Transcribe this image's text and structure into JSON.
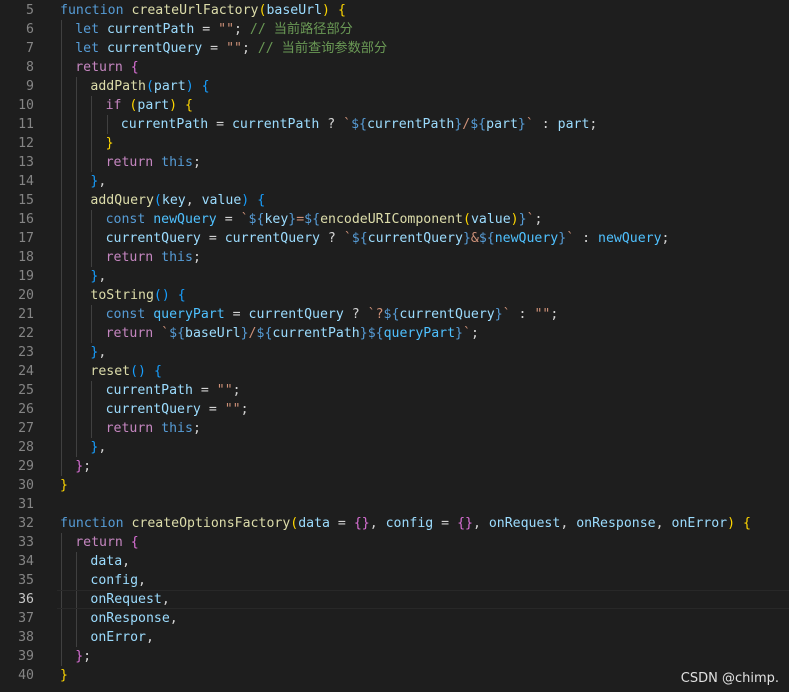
{
  "editor": {
    "language": "javascript",
    "active_line": 36,
    "colors": {
      "background": "#1e1e1e",
      "line_number": "#858585",
      "active_line_number": "#c6c6c6",
      "keyword": "#569cd6",
      "control": "#c586c0",
      "function": "#dcdcaa",
      "variable": "#9cdcfe",
      "constant": "#4fc1ff",
      "string": "#ce9178",
      "comment": "#6a9955",
      "bracket_level_1": "#ffd700",
      "bracket_level_2": "#da70d6",
      "bracket_level_3": "#179fff"
    },
    "lines": [
      {
        "n": "5",
        "guides": 0,
        "tokens": [
          [
            "keyword",
            "function "
          ],
          [
            "func",
            "createUrlFactory"
          ],
          [
            "b1",
            "("
          ],
          [
            "var",
            "baseUrl"
          ],
          [
            "b1",
            ")"
          ],
          [
            "plain",
            " "
          ],
          [
            "b1",
            "{"
          ]
        ]
      },
      {
        "n": "6",
        "guides": 1,
        "tokens": [
          [
            "keyword",
            "let "
          ],
          [
            "var",
            "currentPath"
          ],
          [
            "plain",
            " = "
          ],
          [
            "str",
            "\"\""
          ],
          [
            "plain",
            "; "
          ],
          [
            "comment",
            "// 当前路径部分"
          ]
        ]
      },
      {
        "n": "7",
        "guides": 1,
        "tokens": [
          [
            "keyword",
            "let "
          ],
          [
            "var",
            "currentQuery"
          ],
          [
            "plain",
            " = "
          ],
          [
            "str",
            "\"\""
          ],
          [
            "plain",
            "; "
          ],
          [
            "comment",
            "// 当前查询参数部分"
          ]
        ]
      },
      {
        "n": "8",
        "guides": 1,
        "tokens": [
          [
            "control",
            "return "
          ],
          [
            "b2",
            "{"
          ]
        ]
      },
      {
        "n": "9",
        "guides": 2,
        "tokens": [
          [
            "func",
            "addPath"
          ],
          [
            "b3",
            "("
          ],
          [
            "var",
            "part"
          ],
          [
            "b3",
            ")"
          ],
          [
            "plain",
            " "
          ],
          [
            "b3",
            "{"
          ]
        ]
      },
      {
        "n": "10",
        "guides": 3,
        "tokens": [
          [
            "control",
            "if "
          ],
          [
            "b1",
            "("
          ],
          [
            "var",
            "part"
          ],
          [
            "b1",
            ")"
          ],
          [
            "plain",
            " "
          ],
          [
            "b1",
            "{"
          ]
        ]
      },
      {
        "n": "11",
        "guides": 4,
        "tokens": [
          [
            "var",
            "currentPath"
          ],
          [
            "plain",
            " = "
          ],
          [
            "var",
            "currentPath"
          ],
          [
            "plain",
            " ? "
          ],
          [
            "str",
            "`"
          ],
          [
            "interp",
            "${"
          ],
          [
            "var",
            "currentPath"
          ],
          [
            "interp",
            "}"
          ],
          [
            "str",
            "/"
          ],
          [
            "interp",
            "${"
          ],
          [
            "var",
            "part"
          ],
          [
            "interp",
            "}"
          ],
          [
            "str",
            "`"
          ],
          [
            "plain",
            " : "
          ],
          [
            "var",
            "part"
          ],
          [
            "plain",
            ";"
          ]
        ]
      },
      {
        "n": "12",
        "guides": 3,
        "tokens": [
          [
            "b1",
            "}"
          ]
        ]
      },
      {
        "n": "13",
        "guides": 3,
        "tokens": [
          [
            "control",
            "return "
          ],
          [
            "keyword",
            "this"
          ],
          [
            "plain",
            ";"
          ]
        ]
      },
      {
        "n": "14",
        "guides": 2,
        "tokens": [
          [
            "b3",
            "}"
          ],
          [
            "plain",
            ","
          ]
        ]
      },
      {
        "n": "15",
        "guides": 2,
        "tokens": [
          [
            "func",
            "addQuery"
          ],
          [
            "b3",
            "("
          ],
          [
            "var",
            "key"
          ],
          [
            "plain",
            ", "
          ],
          [
            "var",
            "value"
          ],
          [
            "b3",
            ")"
          ],
          [
            "plain",
            " "
          ],
          [
            "b3",
            "{"
          ]
        ]
      },
      {
        "n": "16",
        "guides": 3,
        "tokens": [
          [
            "keyword",
            "const "
          ],
          [
            "const",
            "newQuery"
          ],
          [
            "plain",
            " = "
          ],
          [
            "str",
            "`"
          ],
          [
            "interp",
            "${"
          ],
          [
            "var",
            "key"
          ],
          [
            "interp",
            "}"
          ],
          [
            "str",
            "="
          ],
          [
            "interp",
            "${"
          ],
          [
            "func",
            "encodeURIComponent"
          ],
          [
            "b1",
            "("
          ],
          [
            "var",
            "value"
          ],
          [
            "b1",
            ")"
          ],
          [
            "interp",
            "}"
          ],
          [
            "str",
            "`"
          ],
          [
            "plain",
            ";"
          ]
        ]
      },
      {
        "n": "17",
        "guides": 3,
        "tokens": [
          [
            "var",
            "currentQuery"
          ],
          [
            "plain",
            " = "
          ],
          [
            "var",
            "currentQuery"
          ],
          [
            "plain",
            " ? "
          ],
          [
            "str",
            "`"
          ],
          [
            "interp",
            "${"
          ],
          [
            "var",
            "currentQuery"
          ],
          [
            "interp",
            "}"
          ],
          [
            "str",
            "&"
          ],
          [
            "interp",
            "${"
          ],
          [
            "const",
            "newQuery"
          ],
          [
            "interp",
            "}"
          ],
          [
            "str",
            "`"
          ],
          [
            "plain",
            " : "
          ],
          [
            "const",
            "newQuery"
          ],
          [
            "plain",
            ";"
          ]
        ]
      },
      {
        "n": "18",
        "guides": 3,
        "tokens": [
          [
            "control",
            "return "
          ],
          [
            "keyword",
            "this"
          ],
          [
            "plain",
            ";"
          ]
        ]
      },
      {
        "n": "19",
        "guides": 2,
        "tokens": [
          [
            "b3",
            "}"
          ],
          [
            "plain",
            ","
          ]
        ]
      },
      {
        "n": "20",
        "guides": 2,
        "tokens": [
          [
            "func",
            "toString"
          ],
          [
            "b3",
            "("
          ],
          [
            "b3",
            ")"
          ],
          [
            "plain",
            " "
          ],
          [
            "b3",
            "{"
          ]
        ]
      },
      {
        "n": "21",
        "guides": 3,
        "tokens": [
          [
            "keyword",
            "const "
          ],
          [
            "const",
            "queryPart"
          ],
          [
            "plain",
            " = "
          ],
          [
            "var",
            "currentQuery"
          ],
          [
            "plain",
            " ? "
          ],
          [
            "str",
            "`?"
          ],
          [
            "interp",
            "${"
          ],
          [
            "var",
            "currentQuery"
          ],
          [
            "interp",
            "}"
          ],
          [
            "str",
            "`"
          ],
          [
            "plain",
            " : "
          ],
          [
            "str",
            "\"\""
          ],
          [
            "plain",
            ";"
          ]
        ]
      },
      {
        "n": "22",
        "guides": 3,
        "tokens": [
          [
            "control",
            "return "
          ],
          [
            "str",
            "`"
          ],
          [
            "interp",
            "${"
          ],
          [
            "var",
            "baseUrl"
          ],
          [
            "interp",
            "}"
          ],
          [
            "str",
            "/"
          ],
          [
            "interp",
            "${"
          ],
          [
            "var",
            "currentPath"
          ],
          [
            "interp",
            "}"
          ],
          [
            "interp",
            "${"
          ],
          [
            "const",
            "queryPart"
          ],
          [
            "interp",
            "}"
          ],
          [
            "str",
            "`"
          ],
          [
            "plain",
            ";"
          ]
        ]
      },
      {
        "n": "23",
        "guides": 2,
        "tokens": [
          [
            "b3",
            "}"
          ],
          [
            "plain",
            ","
          ]
        ]
      },
      {
        "n": "24",
        "guides": 2,
        "tokens": [
          [
            "func",
            "reset"
          ],
          [
            "b3",
            "("
          ],
          [
            "b3",
            ")"
          ],
          [
            "plain",
            " "
          ],
          [
            "b3",
            "{"
          ]
        ]
      },
      {
        "n": "25",
        "guides": 3,
        "tokens": [
          [
            "var",
            "currentPath"
          ],
          [
            "plain",
            " = "
          ],
          [
            "str",
            "\"\""
          ],
          [
            "plain",
            ";"
          ]
        ]
      },
      {
        "n": "26",
        "guides": 3,
        "tokens": [
          [
            "var",
            "currentQuery"
          ],
          [
            "plain",
            " = "
          ],
          [
            "str",
            "\"\""
          ],
          [
            "plain",
            ";"
          ]
        ]
      },
      {
        "n": "27",
        "guides": 3,
        "tokens": [
          [
            "control",
            "return "
          ],
          [
            "keyword",
            "this"
          ],
          [
            "plain",
            ";"
          ]
        ]
      },
      {
        "n": "28",
        "guides": 2,
        "tokens": [
          [
            "b3",
            "}"
          ],
          [
            "plain",
            ","
          ]
        ]
      },
      {
        "n": "29",
        "guides": 1,
        "tokens": [
          [
            "b2",
            "}"
          ],
          [
            "plain",
            ";"
          ]
        ]
      },
      {
        "n": "30",
        "guides": 0,
        "tokens": [
          [
            "b1",
            "}"
          ]
        ]
      },
      {
        "n": "31",
        "guides": 0,
        "tokens": []
      },
      {
        "n": "32",
        "guides": 0,
        "tokens": [
          [
            "keyword",
            "function "
          ],
          [
            "func",
            "createOptionsFactory"
          ],
          [
            "b1",
            "("
          ],
          [
            "var",
            "data"
          ],
          [
            "plain",
            " = "
          ],
          [
            "b2",
            "{}"
          ],
          [
            "plain",
            ", "
          ],
          [
            "var",
            "config"
          ],
          [
            "plain",
            " = "
          ],
          [
            "b2",
            "{}"
          ],
          [
            "plain",
            ", "
          ],
          [
            "var",
            "onRequest"
          ],
          [
            "plain",
            ", "
          ],
          [
            "var",
            "onResponse"
          ],
          [
            "plain",
            ", "
          ],
          [
            "var",
            "onError"
          ],
          [
            "b1",
            ")"
          ],
          [
            "plain",
            " "
          ],
          [
            "b1",
            "{"
          ]
        ]
      },
      {
        "n": "33",
        "guides": 1,
        "tokens": [
          [
            "control",
            "return "
          ],
          [
            "b2",
            "{"
          ]
        ]
      },
      {
        "n": "34",
        "guides": 2,
        "tokens": [
          [
            "var",
            "data"
          ],
          [
            "plain",
            ","
          ]
        ]
      },
      {
        "n": "35",
        "guides": 2,
        "tokens": [
          [
            "var",
            "config"
          ],
          [
            "plain",
            ","
          ]
        ]
      },
      {
        "n": "36",
        "guides": 2,
        "tokens": [
          [
            "var",
            "onRequest"
          ],
          [
            "plain",
            ","
          ]
        ]
      },
      {
        "n": "37",
        "guides": 2,
        "tokens": [
          [
            "var",
            "onResponse"
          ],
          [
            "plain",
            ","
          ]
        ]
      },
      {
        "n": "38",
        "guides": 2,
        "tokens": [
          [
            "var",
            "onError"
          ],
          [
            "plain",
            ","
          ]
        ]
      },
      {
        "n": "39",
        "guides": 1,
        "tokens": [
          [
            "b2",
            "}"
          ],
          [
            "plain",
            ";"
          ]
        ]
      },
      {
        "n": "40",
        "guides": 0,
        "tokens": [
          [
            "b1",
            "}"
          ]
        ]
      }
    ]
  },
  "watermark": "CSDN @chimp."
}
